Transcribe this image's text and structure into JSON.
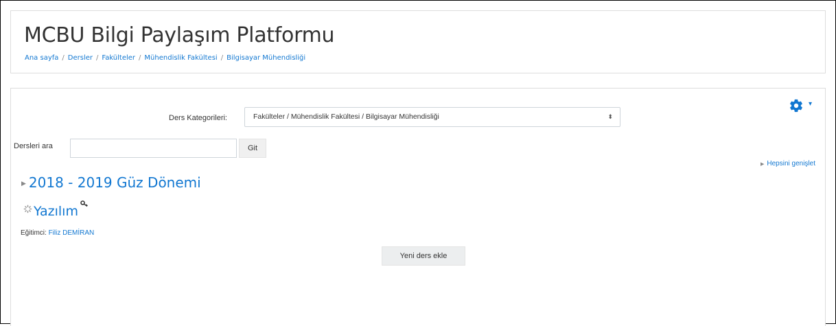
{
  "header": {
    "title": "MCBU Bilgi Paylaşım Platformu",
    "breadcrumb": [
      "Ana sayfa",
      "Dersler",
      "Fakülteler",
      "Mühendislik Fakültesi",
      "Bilgisayar Mühendisliği"
    ],
    "separator": "/"
  },
  "settings": {
    "icon": "gear-icon",
    "caret": "▾"
  },
  "category": {
    "label": "Ders Kategorileri:",
    "selected": "Fakülteler / Mühendislik Fakültesi / Bilgisayar Mühendisliği"
  },
  "search": {
    "label": "Dersleri ara",
    "value": "",
    "button": "Git"
  },
  "expand_all": "Hepsini genişlet",
  "semester": "2018 - 2019 Güz Dönemi",
  "course": {
    "name": "Yazılım",
    "teacher_label": "Eğitimci:",
    "teacher_name": "Filiz DEMİRAN"
  },
  "add_course_button": "Yeni ders ekle",
  "colors": {
    "link": "#1177d1",
    "text": "#333333",
    "border": "#dcdcdc"
  }
}
